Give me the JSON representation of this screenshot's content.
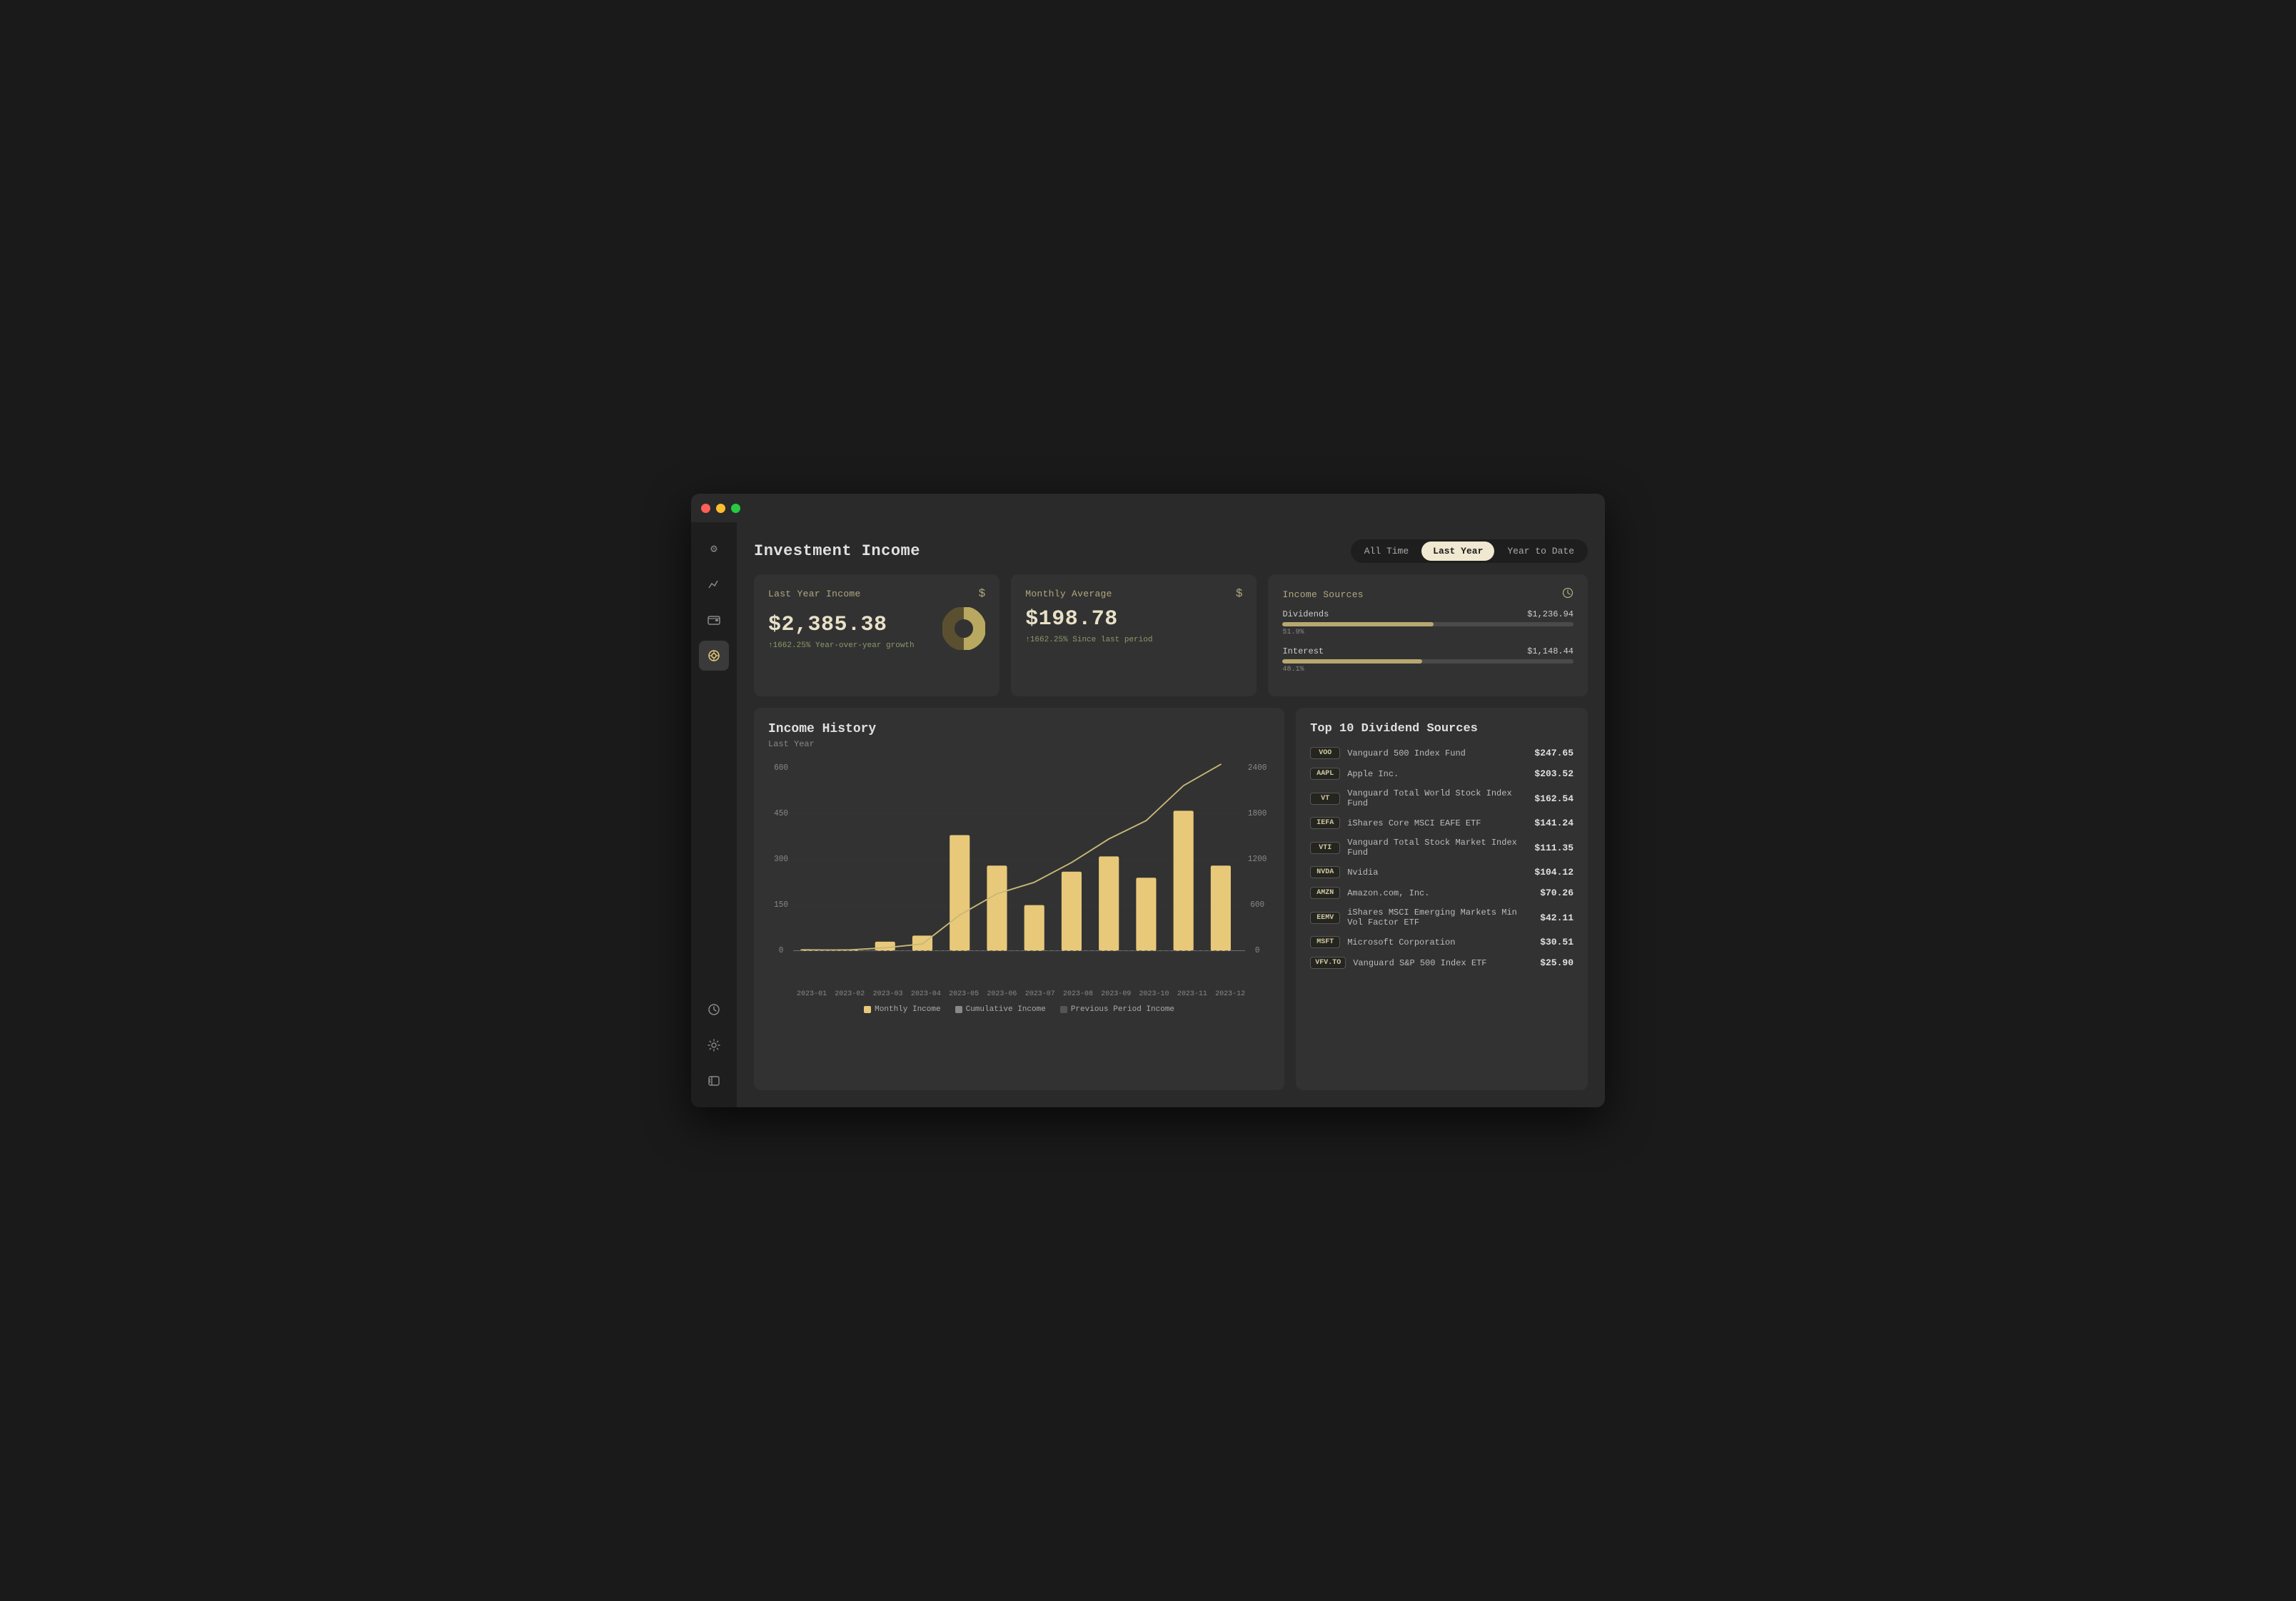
{
  "window": {
    "title": "Investment Income"
  },
  "sidebar": {
    "icons": [
      {
        "name": "settings-icon",
        "symbol": "⚙",
        "active": false,
        "position": "top"
      },
      {
        "name": "chart-icon",
        "symbol": "📈",
        "active": false
      },
      {
        "name": "wallet-icon",
        "symbol": "▤",
        "active": false
      },
      {
        "name": "income-icon",
        "symbol": "◈",
        "active": true
      },
      {
        "name": "history-icon",
        "symbol": "⟳",
        "active": false
      },
      {
        "name": "gear-icon",
        "symbol": "⚙",
        "active": false,
        "position": "bottom"
      },
      {
        "name": "sidebar-toggle-icon",
        "symbol": "⊟",
        "active": false,
        "position": "bottom2"
      }
    ]
  },
  "header": {
    "title": "Investment Income",
    "time_filters": [
      "All Time",
      "Last Year",
      "Year to Date"
    ],
    "active_filter": "Last Year"
  },
  "cards": {
    "last_year": {
      "label": "Last Year Income",
      "value": "$2,385.38",
      "growth_text": "↑1662.25% Year-over-year growth",
      "icon": "$"
    },
    "monthly_avg": {
      "label": "Monthly Average",
      "value": "$198.78",
      "growth_text": "↑1662.25% Since last period",
      "icon": "$"
    },
    "income_sources": {
      "label": "Income Sources",
      "icon": "clock",
      "sources": [
        {
          "name": "Dividends",
          "amount": "$1,236.94",
          "percent": 51.9,
          "bar_width": 51.9
        },
        {
          "name": "Interest",
          "amount": "$1,148.44",
          "percent": 48.1,
          "bar_width": 48.1
        }
      ]
    }
  },
  "income_history": {
    "title": "Income History",
    "subtitle": "Last Year",
    "y_left_max": 600,
    "y_left_labels": [
      600,
      450,
      300,
      150,
      0
    ],
    "y_right_labels": [
      2400,
      1800,
      1200,
      600,
      0
    ],
    "x_labels": [
      "2023-01",
      "2023-02",
      "2023-03",
      "2023-04",
      "2023-05",
      "2023-06",
      "2023-07",
      "2023-08",
      "2023-09",
      "2023-10",
      "2023-11",
      "2023-12"
    ],
    "bars": [
      5,
      5,
      30,
      50,
      380,
      280,
      150,
      260,
      310,
      240,
      460,
      280
    ],
    "legend": [
      {
        "label": "Monthly Income",
        "color": "#e8c97a"
      },
      {
        "label": "Cumulative Income",
        "color": "#888"
      },
      {
        "label": "Previous Period Income",
        "color": "#555"
      }
    ]
  },
  "top_dividends": {
    "title": "Top 10 Dividend Sources",
    "items": [
      {
        "ticker": "VOO",
        "name": "Vanguard 500 Index Fund",
        "amount": "$247.65"
      },
      {
        "ticker": "AAPL",
        "name": "Apple Inc.",
        "amount": "$203.52"
      },
      {
        "ticker": "VT",
        "name": "Vanguard Total World Stock Index Fund",
        "amount": "$162.54"
      },
      {
        "ticker": "IEFA",
        "name": "iShares Core MSCI EAFE ETF",
        "amount": "$141.24"
      },
      {
        "ticker": "VTI",
        "name": "Vanguard Total Stock Market Index Fund",
        "amount": "$111.35"
      },
      {
        "ticker": "NVDA",
        "name": "Nvidia",
        "amount": "$104.12"
      },
      {
        "ticker": "AMZN",
        "name": "Amazon.com, Inc.",
        "amount": "$70.26"
      },
      {
        "ticker": "EEMV",
        "name": "iShares MSCI Emerging Markets Min Vol Factor ETF",
        "amount": "$42.11"
      },
      {
        "ticker": "MSFT",
        "name": "Microsoft Corporation",
        "amount": "$30.51"
      },
      {
        "ticker": "VFV.TO",
        "name": "Vanguard S&P 500 Index ETF",
        "amount": "$25.90"
      }
    ]
  }
}
